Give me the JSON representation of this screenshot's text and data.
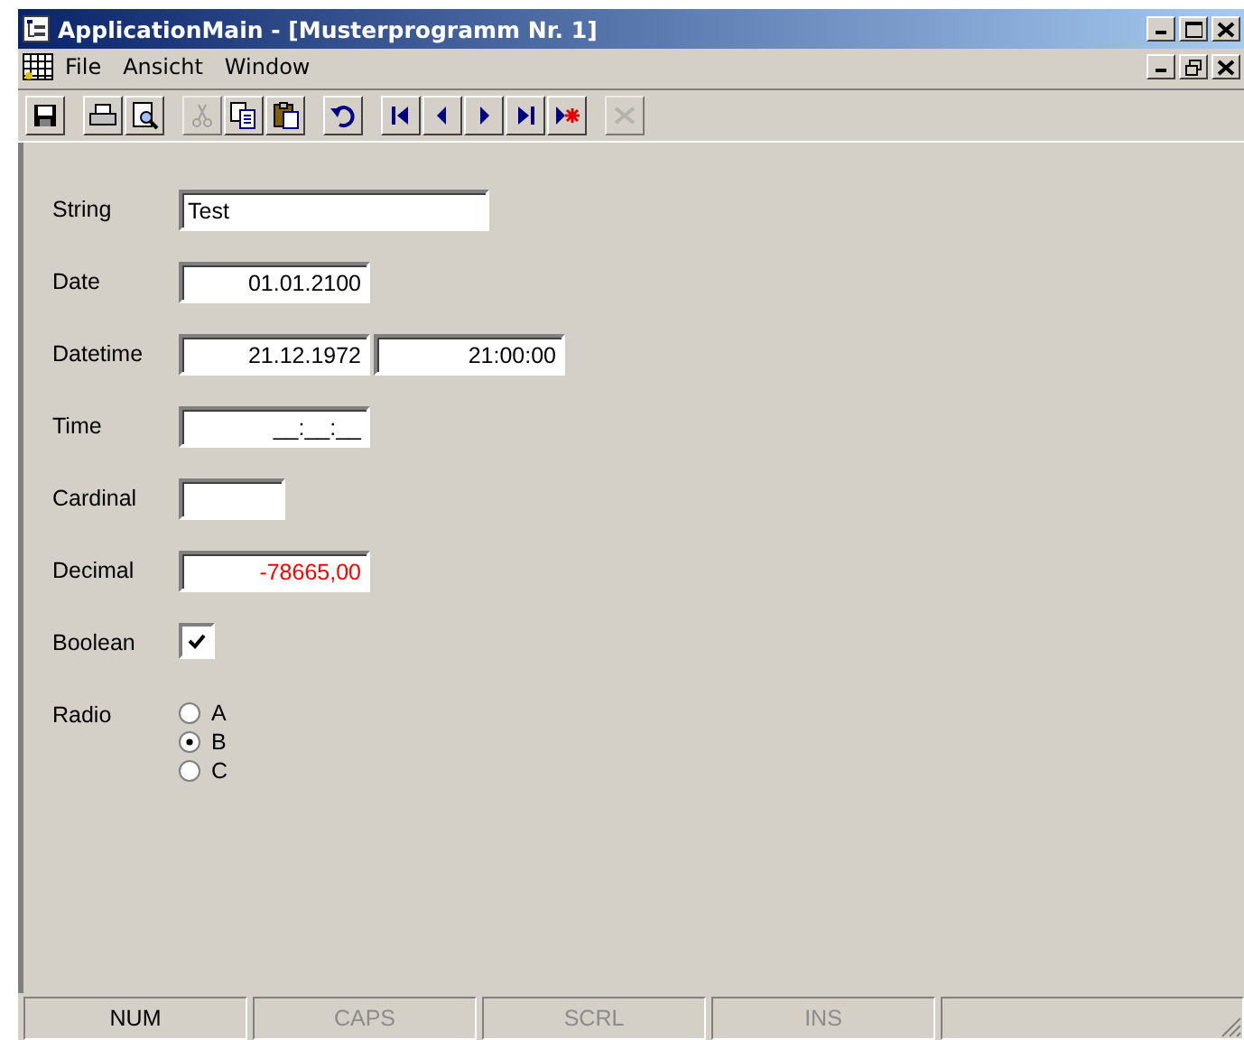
{
  "window": {
    "title": "ApplicationMain - [Musterprogramm Nr. 1]"
  },
  "menu": [
    "File",
    "Ansicht",
    "Window"
  ],
  "toolbar": [
    {
      "kind": "save",
      "disabled": false
    },
    {
      "kind": "separator"
    },
    {
      "kind": "print",
      "disabled": false
    },
    {
      "kind": "preview",
      "disabled": false
    },
    {
      "kind": "separator"
    },
    {
      "kind": "cut",
      "disabled": true
    },
    {
      "kind": "copy",
      "disabled": false
    },
    {
      "kind": "paste",
      "disabled": false
    },
    {
      "kind": "separator"
    },
    {
      "kind": "undo",
      "disabled": false
    },
    {
      "kind": "separator"
    },
    {
      "kind": "first",
      "disabled": false
    },
    {
      "kind": "prev",
      "disabled": false
    },
    {
      "kind": "next",
      "disabled": false
    },
    {
      "kind": "last",
      "disabled": false
    },
    {
      "kind": "new",
      "disabled": false
    },
    {
      "kind": "separator"
    },
    {
      "kind": "delete",
      "disabled": true
    }
  ],
  "fields": [
    {
      "kind": "string",
      "label": "String",
      "values": [
        "Test"
      ]
    },
    {
      "kind": "date",
      "label": "Date",
      "values": [
        "01.01.2100"
      ]
    },
    {
      "kind": "datetime",
      "label": "Datetime",
      "values": [
        "21.12.1972",
        "21:00:00"
      ]
    },
    {
      "kind": "time",
      "label": "Time",
      "values": [
        "__:__:__"
      ]
    },
    {
      "kind": "cardinal",
      "label": "Cardinal"
    },
    {
      "kind": "decimal",
      "label": "Decimal",
      "values": [
        "-78665,00"
      ],
      "color": "#ff0000"
    },
    {
      "kind": "checkbox",
      "label": "Boolean",
      "checked": true
    },
    {
      "kind": "radio",
      "label": "Radio",
      "options": [
        {
          "label": "A",
          "selected": false
        },
        {
          "label": "B",
          "selected": true
        },
        {
          "label": "C",
          "selected": false
        }
      ]
    }
  ],
  "status_bar": [
    {
      "text": "NUM",
      "disabled": false
    },
    {
      "text": "CAPS",
      "disabled": true
    },
    {
      "text": "SCRL",
      "disabled": true
    },
    {
      "text": "INS",
      "disabled": true
    }
  ]
}
